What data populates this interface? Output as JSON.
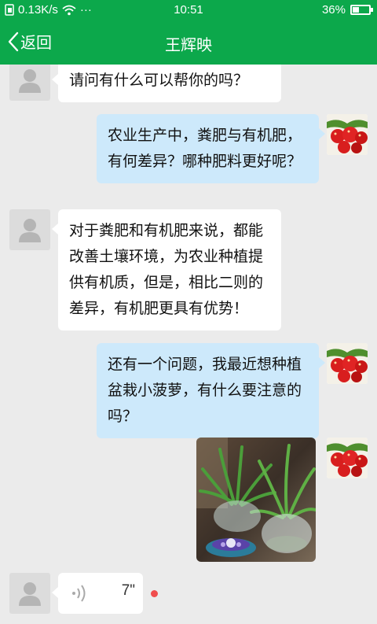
{
  "status_bar": {
    "net_speed": "0.13K/s",
    "more": "···",
    "time": "10:51",
    "battery_percent": "36%",
    "battery_level": 0.36
  },
  "header": {
    "back_label": "返回",
    "title": "王辉映"
  },
  "messages": [
    {
      "side": "in",
      "type": "text",
      "text": "请问有什么可以帮你的吗？"
    },
    {
      "side": "out",
      "type": "text",
      "text": "农业生产中，粪肥与有机肥，有何差异？哪种肥料更好呢？"
    },
    {
      "side": "in",
      "type": "text",
      "text": "对于粪肥和有机肥来说，都能改善土壤环境，为农业种植提供有机质，但是，相比二则的差异，有机肥更具有优势！"
    },
    {
      "side": "out",
      "type": "text",
      "text": "还有一个问题，我最近想种植盆栽小菠萝，有什么要注意的吗？"
    },
    {
      "side": "out",
      "type": "image",
      "description": "pineapple-plants-in-glass-vases"
    },
    {
      "side": "in",
      "type": "voice",
      "duration": "7\""
    }
  ],
  "colors": {
    "brand_green": "#0ca84b",
    "outgoing_bubble": "#cde9fb",
    "incoming_bubble": "#ffffff",
    "background": "#ebebeb",
    "unread_dot": "#f04d4d"
  }
}
